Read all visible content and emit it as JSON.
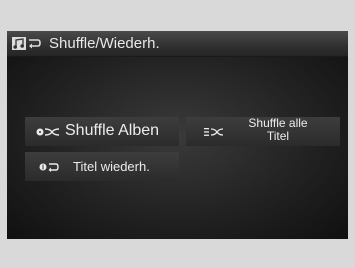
{
  "header": {
    "title": "Shuffle/Wiederh.",
    "icon": "music-repeat-icon"
  },
  "options": {
    "shuffle_albums": {
      "label": "Shuffle Alben",
      "icon": "shuffle-albums-icon"
    },
    "shuffle_all_tracks": {
      "label_line1": "Shuffle alle",
      "label_line2": "Titel",
      "icon": "shuffle-all-icon"
    },
    "repeat_track": {
      "label": "Titel wiederh.",
      "icon": "repeat-one-icon"
    }
  },
  "colors": {
    "text": "#ececec",
    "button_bg": "#363636",
    "screen_bg": "#222222"
  }
}
